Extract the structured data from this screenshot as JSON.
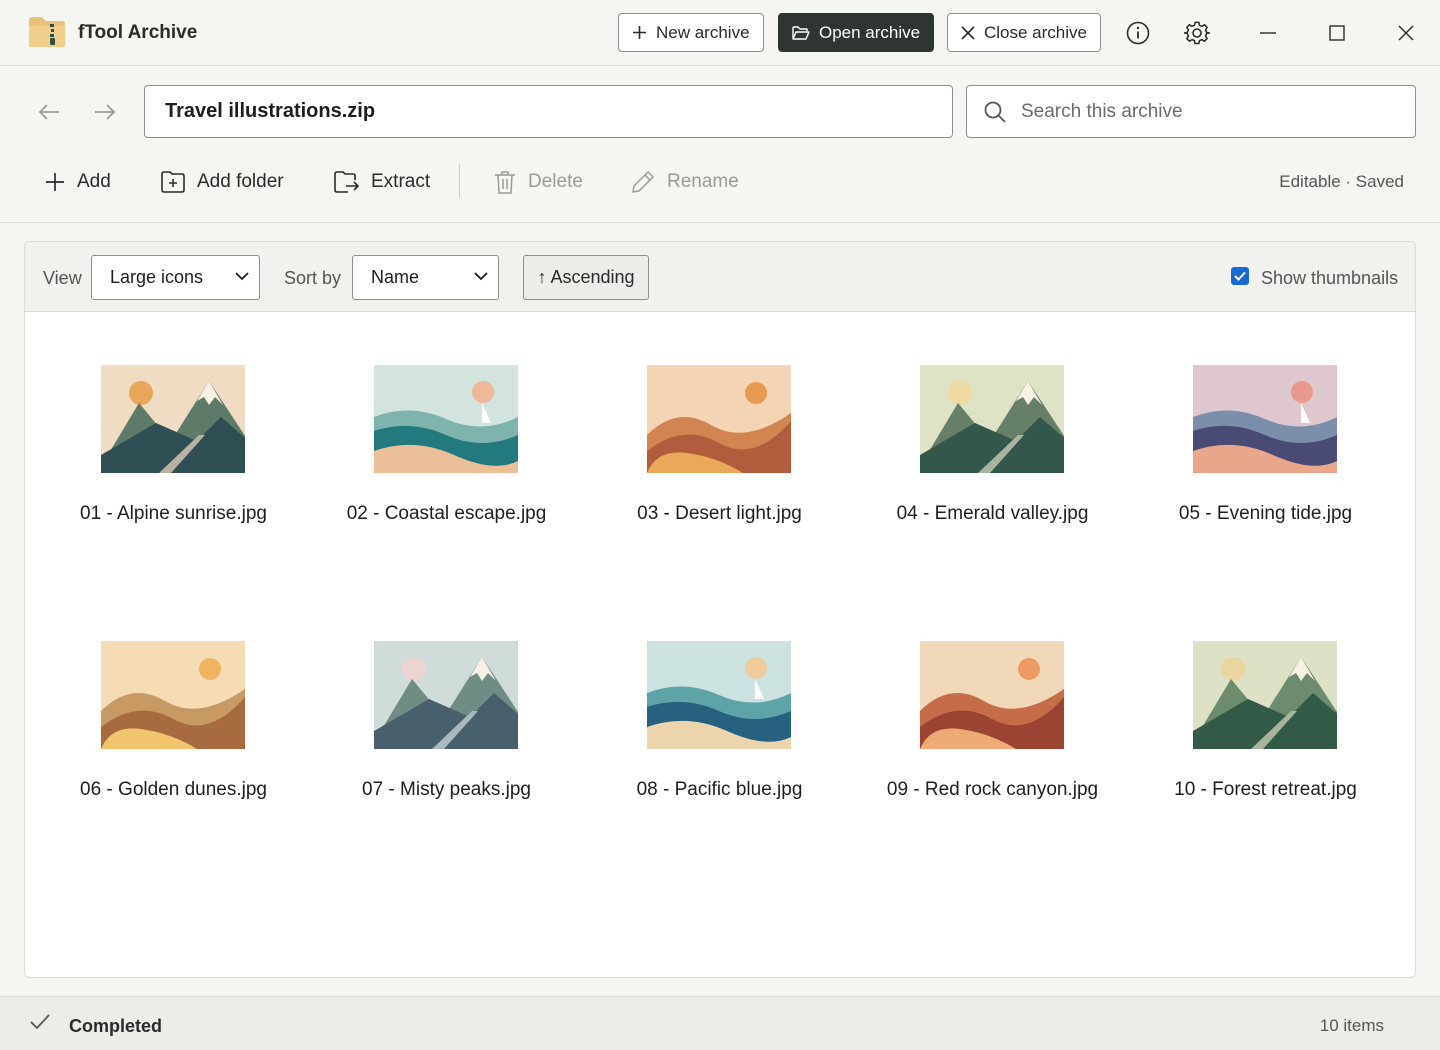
{
  "app": {
    "title": "fTool Archive"
  },
  "titlebar": {
    "new_archive": "New archive",
    "open_archive": "Open archive",
    "close_archive": "Close archive"
  },
  "nav": {
    "path": "Travel illustrations.zip",
    "search_placeholder": "Search this archive"
  },
  "toolbar": {
    "add": "Add",
    "add_folder": "Add folder",
    "extract": "Extract",
    "delete": "Delete",
    "rename": "Rename",
    "status": "Editable · Saved"
  },
  "view_controls": {
    "view_label": "View",
    "view_value": "Large icons",
    "sort_label": "Sort by",
    "sort_value": "Name",
    "order": "↑ Ascending",
    "show_thumbnails_label": "Show thumbnails",
    "show_thumbnails_checked": true
  },
  "files": [
    {
      "name": "01 - Alpine sunrise.jpg",
      "scene": "mountain",
      "colors": {
        "sky": "#f0dcc2",
        "sun": "#e8a65a",
        "back": "#5e7a69",
        "front": "#2f4f55",
        "snow": "#f7f0e4",
        "path": "#b9b1a2"
      }
    },
    {
      "name": "02 - Coastal escape.jpg",
      "scene": "sea",
      "colors": {
        "sky": "#d3e3de",
        "sun": "#efb999",
        "wave1": "#7fb3ad",
        "wave2": "#237a7e",
        "sand": "#ebbf98",
        "sail": "#ffffff"
      }
    },
    {
      "name": "03 - Desert light.jpg",
      "scene": "desert",
      "colors": {
        "sky": "#f3d4b4",
        "sun": "#e99a52",
        "dune1": "#d28550",
        "dune2": "#b15c3c",
        "dune3": "#eaa95a"
      }
    },
    {
      "name": "04 - Emerald valley.jpg",
      "scene": "mountain",
      "colors": {
        "sky": "#dde3c4",
        "sun": "#eed9a2",
        "back": "#657f69",
        "front": "#34574b",
        "snow": "#f7f0e4",
        "path": "#a8b3a0"
      }
    },
    {
      "name": "05 - Evening tide.jpg",
      "scene": "sea",
      "colors": {
        "sky": "#dec7cf",
        "sun": "#ea9a8a",
        "wave1": "#7b8fab",
        "wave2": "#494b75",
        "sand": "#e9a68a",
        "sail": "#ffffff"
      }
    },
    {
      "name": "06 - Golden dunes.jpg",
      "scene": "desert",
      "colors": {
        "sky": "#f5dcb4",
        "sun": "#f0b460",
        "dune1": "#c79a63",
        "dune2": "#a86a3f",
        "dune3": "#f1c46e"
      }
    },
    {
      "name": "07 - Misty peaks.jpg",
      "scene": "mountain",
      "colors": {
        "sky": "#cfdcd9",
        "sun": "#ecd4d1",
        "back": "#6f8d85",
        "front": "#47606b",
        "snow": "#f7f0e4",
        "path": "#a9b9bd"
      }
    },
    {
      "name": "08 - Pacific blue.jpg",
      "scene": "sea",
      "colors": {
        "sky": "#cbe2e0",
        "sun": "#f0cb9b",
        "wave1": "#5da3a8",
        "wave2": "#27617f",
        "sand": "#ecd5ad",
        "sail": "#ffffff"
      }
    },
    {
      "name": "09 - Red rock canyon.jpg",
      "scene": "desert",
      "colors": {
        "sky": "#f1d8b9",
        "sun": "#ee9a64",
        "dune1": "#c56d48",
        "dune2": "#9b4433",
        "dune3": "#eeaa74"
      }
    },
    {
      "name": "10 - Forest retreat.jpg",
      "scene": "mountain",
      "colors": {
        "sky": "#dde1c6",
        "sun": "#ebd6a0",
        "back": "#6d8c6d",
        "front": "#335a47",
        "snow": "#f7f0e4",
        "path": "#a9b29c"
      }
    }
  ],
  "statusbar": {
    "state": "Completed",
    "count": "10 items"
  }
}
